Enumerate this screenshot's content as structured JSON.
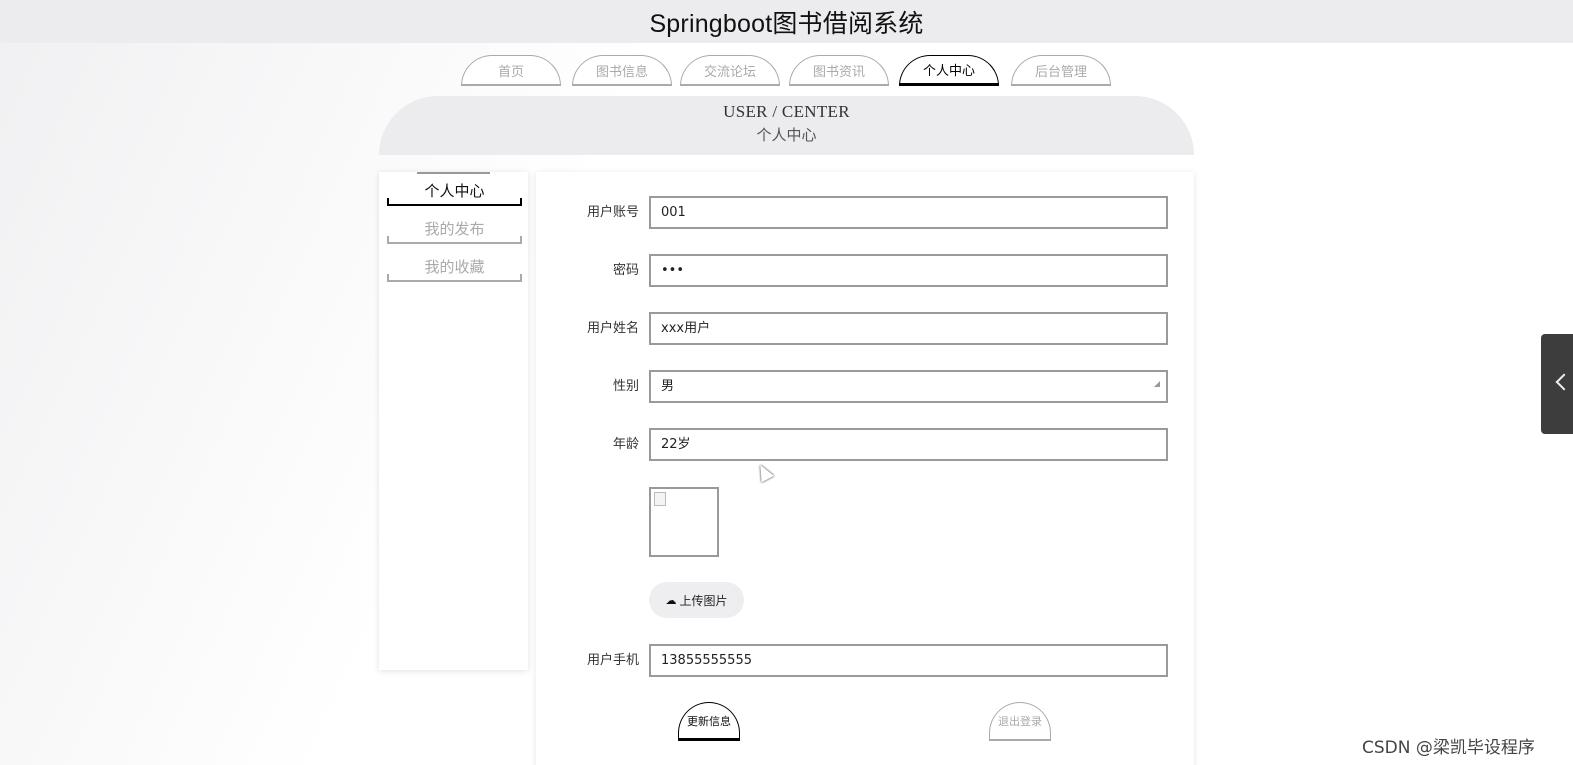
{
  "header": {
    "title": "Springboot图书借阅系统"
  },
  "nav": {
    "items": [
      {
        "label": "首页"
      },
      {
        "label": "图书信息"
      },
      {
        "label": "交流论坛"
      },
      {
        "label": "图书资讯"
      },
      {
        "label": "个人中心"
      },
      {
        "label": "后台管理"
      }
    ],
    "active": "个人中心"
  },
  "banner": {
    "en": "USER / CENTER",
    "zh": "个人中心"
  },
  "sidebar": {
    "items": [
      {
        "label": "个人中心"
      },
      {
        "label": "我的发布"
      },
      {
        "label": "我的收藏"
      }
    ]
  },
  "form": {
    "account": {
      "label": "用户账号",
      "value": "001"
    },
    "password": {
      "label": "密码",
      "value": "•••"
    },
    "name": {
      "label": "用户姓名",
      "value": "xxx用户"
    },
    "gender": {
      "label": "性别",
      "value": "男"
    },
    "age": {
      "label": "年龄",
      "value": "22岁"
    },
    "upload_label": "上传图片",
    "phone": {
      "label": "用户手机",
      "value": "13855555555"
    },
    "update_label": "更新信息",
    "logout_label": "退出登录"
  },
  "watermark": "CSDN @梁凯毕设程序"
}
